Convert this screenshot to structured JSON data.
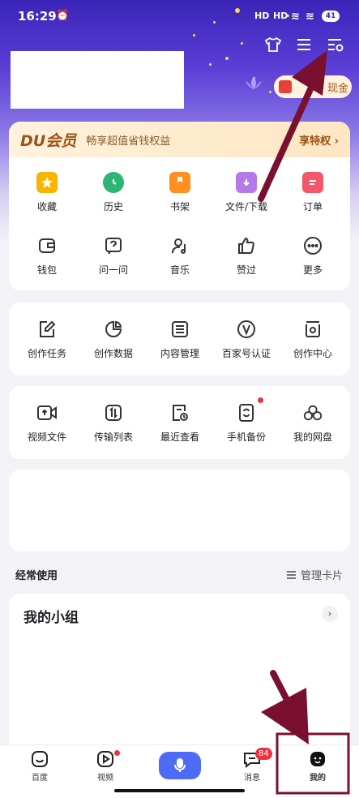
{
  "status_bar": {
    "time": "16:29",
    "battery": "41",
    "signal1": "HD",
    "signal2": "HD"
  },
  "header": {
    "icons": [
      "tshirt-icon",
      "menu-icon",
      "settings-list-icon"
    ],
    "cash_label": "现金"
  },
  "vip": {
    "logo": "DU会员",
    "slogan": "畅享超值省钱权益",
    "more": "享特权 ›"
  },
  "quick_grid": [
    {
      "label": "收藏",
      "icon": "star-icon",
      "color": "#f7b500"
    },
    {
      "label": "历史",
      "icon": "clock-icon",
      "color": "#2bb673"
    },
    {
      "label": "书架",
      "icon": "bookshelf-icon",
      "color": "#ff8f1f"
    },
    {
      "label": "文件/下载",
      "icon": "download-folder-icon",
      "color": "#b37ae8"
    },
    {
      "label": "订单",
      "icon": "order-icon",
      "color": "#f5566a"
    },
    {
      "label": "钱包",
      "icon": "wallet-icon",
      "color": "#333"
    },
    {
      "label": "问一问",
      "icon": "question-icon",
      "color": "#333"
    },
    {
      "label": "音乐",
      "icon": "music-icon",
      "color": "#333"
    },
    {
      "label": "赞过",
      "icon": "thumbs-up-icon",
      "color": "#333"
    },
    {
      "label": "更多",
      "icon": "more-icon",
      "color": "#333"
    }
  ],
  "creator_grid": [
    {
      "label": "创作任务",
      "icon": "edit-task-icon"
    },
    {
      "label": "创作数据",
      "icon": "pie-chart-icon"
    },
    {
      "label": "内容管理",
      "icon": "list-icon"
    },
    {
      "label": "百家号认证",
      "icon": "verified-v-icon"
    },
    {
      "label": "创作中心",
      "icon": "creator-center-icon"
    }
  ],
  "files_grid": [
    {
      "label": "视频文件",
      "icon": "video-file-icon"
    },
    {
      "label": "传输列表",
      "icon": "transfer-icon"
    },
    {
      "label": "最近查看",
      "icon": "recent-icon"
    },
    {
      "label": "手机备份",
      "icon": "backup-icon"
    },
    {
      "label": "我的网盘",
      "icon": "cloud-disk-icon"
    }
  ],
  "section": {
    "title": "经常使用",
    "manage": "管理卡片"
  },
  "group": {
    "title": "我的小组",
    "arrow": "›"
  },
  "tabbar": {
    "items": [
      {
        "label": "百度",
        "icon": "baidu-home-icon"
      },
      {
        "label": "视频",
        "icon": "video-play-icon"
      },
      {
        "label": "",
        "icon": "microphone-icon"
      },
      {
        "label": "消息",
        "icon": "message-icon",
        "badge": "84"
      },
      {
        "label": "我的",
        "icon": "profile-icon"
      }
    ]
  },
  "colors": {
    "accent": "#4e6bf5",
    "annotation": "#7a1030"
  }
}
